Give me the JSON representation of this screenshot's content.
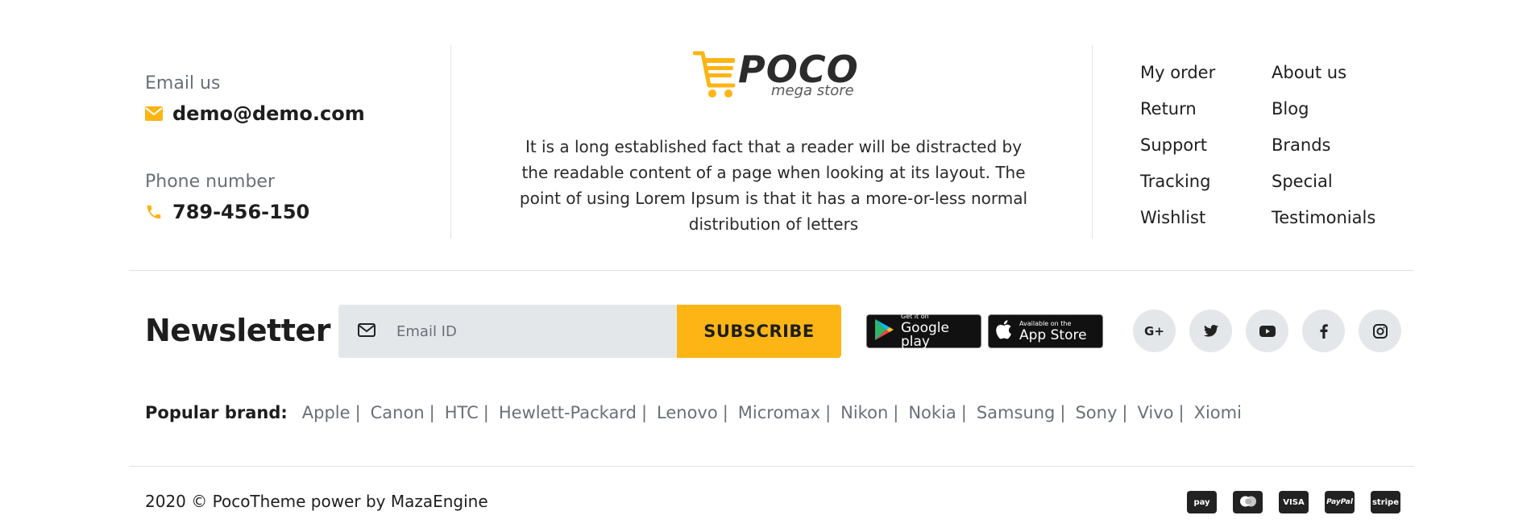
{
  "contact": {
    "email_label": "Email us",
    "email_value": "demo@demo.com",
    "phone_label": "Phone number",
    "phone_value": "789-456-150"
  },
  "brand": {
    "name": "POCO",
    "tagline": "mega store",
    "description": "It is a long established fact that a reader will be distracted by the readable content of a page when looking at its layout. The point of using Lorem Ipsum is that it has a more-or-less normal distribution of letters"
  },
  "links": {
    "col1": [
      "My order",
      "Return",
      "Support",
      "Tracking",
      "Wishlist"
    ],
    "col2": [
      "About us",
      "Blog",
      "Brands",
      "Special",
      "Testimonials"
    ]
  },
  "newsletter": {
    "title": "Newsletter",
    "placeholder": "Email ID",
    "button_label": "SUBSCRIBE"
  },
  "app_badges": {
    "google_small": "Get it on",
    "google_big": "Google play",
    "apple_small": "Available on the",
    "apple_big": "App Store"
  },
  "socials": {
    "google_plus": "G+",
    "icons": [
      "google-plus-icon",
      "twitter-icon",
      "youtube-icon",
      "facebook-icon",
      "instagram-icon"
    ]
  },
  "popular_brands": {
    "label": "Popular brand:",
    "items": [
      "Apple",
      "Canon",
      "HTC",
      "Hewlett-Packard",
      "Lenovo",
      "Micromax",
      "Nikon",
      "Nokia",
      "Samsung",
      "Sony",
      "Vivo",
      "Xiomi"
    ]
  },
  "copyright": "2020 © PocoTheme power by MazaEngine",
  "payments": {
    "amazon": "pay",
    "visa": "VISA",
    "paypal": "PayPal",
    "stripe": "stripe",
    "icons": [
      "amazon-pay-icon",
      "mastercard-icon",
      "visa-icon",
      "paypal-icon",
      "stripe-icon"
    ]
  },
  "colors": {
    "accent": "#fdb515",
    "muted_text": "#6b6f77",
    "input_bg": "#e4e7ea"
  }
}
